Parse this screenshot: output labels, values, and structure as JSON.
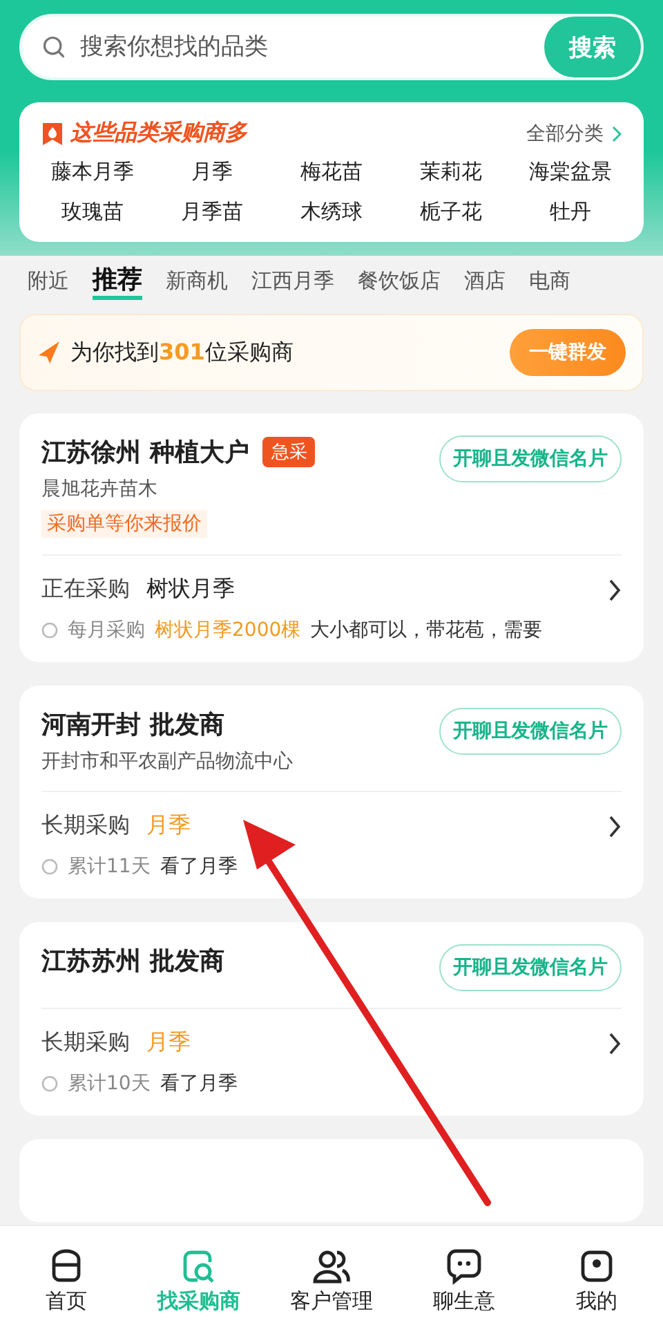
{
  "search": {
    "placeholder": "搜索你想找的品类",
    "button": "搜索"
  },
  "categories": {
    "title": "这些品类采购商多",
    "all_link": "全部分类",
    "items": [
      "藤本月季",
      "月季",
      "梅花苗",
      "茉莉花",
      "海棠盆景",
      "玫瑰苗",
      "月季苗",
      "木绣球",
      "栀子花",
      "牡丹"
    ]
  },
  "tabs": [
    {
      "label": "附近",
      "selected": false
    },
    {
      "label": "推荐",
      "selected": true
    },
    {
      "label": "新商机",
      "selected": false
    },
    {
      "label": "江西月季",
      "selected": false
    },
    {
      "label": "餐饮饭店",
      "selected": false
    },
    {
      "label": "酒店",
      "selected": false
    },
    {
      "label": "电商",
      "selected": false
    }
  ],
  "banner": {
    "text_before": "为你找到",
    "count": "301",
    "text_after": "位采购商",
    "button": "一键群发"
  },
  "buyers": [
    {
      "title": "江苏徐州 种植大户",
      "badge": "急采",
      "subtitle": "晨旭花卉苗木",
      "tag": "采购单等你来报价",
      "button": "开聊且发微信名片",
      "purchase_label": "正在采购",
      "purchase_item": "树状月季",
      "item_highlight": false,
      "detail": [
        {
          "text": "每月采购",
          "kind": "muted"
        },
        {
          "text": "树状月季2000棵",
          "kind": "accent"
        },
        {
          "text": "大小都可以，带花苞，需要",
          "kind": "normal"
        }
      ]
    },
    {
      "title": "河南开封 批发商",
      "subtitle": "开封市和平农副产品物流中心",
      "button": "开聊且发微信名片",
      "purchase_label": "长期采购",
      "purchase_item": "月季",
      "item_highlight": true,
      "detail": [
        {
          "text": "累计11天",
          "kind": "muted"
        },
        {
          "text": "看了月季",
          "kind": "normal"
        }
      ]
    },
    {
      "title": "江苏苏州 批发商",
      "button": "开聊且发微信名片",
      "purchase_label": "长期采购",
      "purchase_item": "月季",
      "item_highlight": true,
      "detail": [
        {
          "text": "累计10天",
          "kind": "muted"
        },
        {
          "text": "看了月季",
          "kind": "normal"
        }
      ]
    }
  ],
  "nav": [
    {
      "label": "首页",
      "selected": false
    },
    {
      "label": "找采购商",
      "selected": true
    },
    {
      "label": "客户管理",
      "selected": false
    },
    {
      "label": "聊生意",
      "selected": false
    },
    {
      "label": "我的",
      "selected": false
    }
  ]
}
